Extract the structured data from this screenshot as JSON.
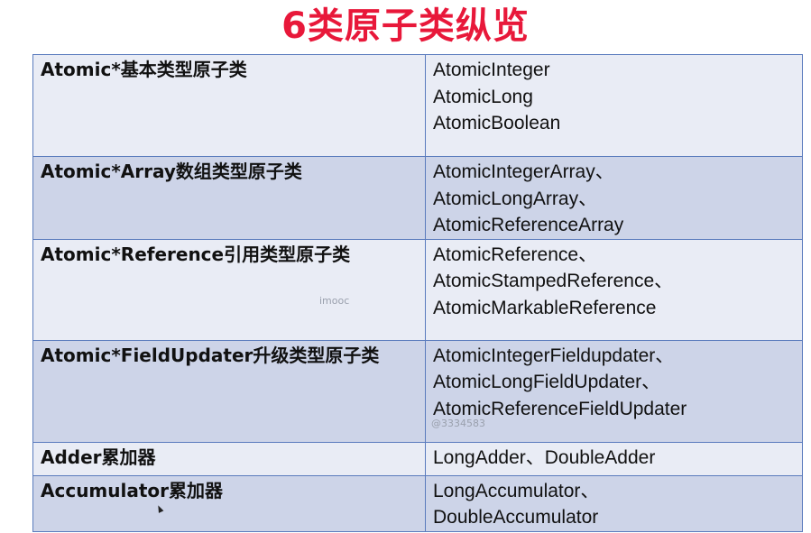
{
  "title": "6类原子类纵览",
  "rows": [
    {
      "category": "Atomic*基本类型原子类",
      "members": [
        "AtomicInteger",
        "AtomicLong",
        "AtomicBoolean"
      ]
    },
    {
      "category": "Atomic*Array数组类型原子类",
      "members": [
        "AtomicIntegerArray、",
        "AtomicLongArray、",
        "AtomicReferenceArray"
      ]
    },
    {
      "category": "Atomic*Reference引用类型原子类",
      "members": [
        "AtomicReference、",
        "AtomicStampedReference、",
        "AtomicMarkableReference"
      ]
    },
    {
      "category": "Atomic*FieldUpdater升级类型原子类",
      "members": [
        "AtomicIntegerFieldupdater、",
        "AtomicLongFieldUpdater、",
        "AtomicReferenceFieldUpdater"
      ]
    },
    {
      "category": "Adder累加器",
      "members": [
        "LongAdder、DoubleAdder"
      ]
    },
    {
      "category": "Accumulator累加器",
      "members": [
        "LongAccumulator、",
        "DoubleAccumulator"
      ]
    }
  ],
  "watermarks": {
    "imooc": "imooc",
    "user_id": "@3334583"
  }
}
